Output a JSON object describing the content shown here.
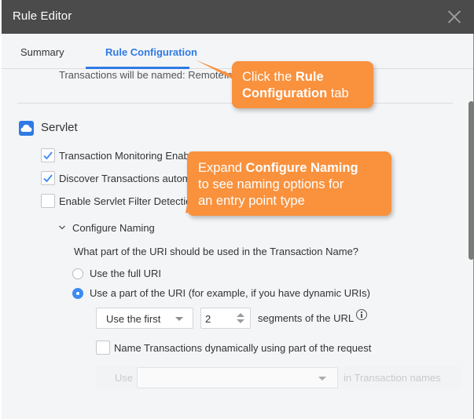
{
  "window": {
    "title": "Rule Editor",
    "close_icon": "close-icon"
  },
  "tabs": [
    {
      "label": "Summary",
      "active": false
    },
    {
      "label": "Rule Configuration",
      "active": true
    }
  ],
  "colors": {
    "accent": "#2f7ae5",
    "titlebar": "#4b4b4b",
    "callout": "#f9913d",
    "background": "#f4f5f7"
  },
  "content": {
    "named_text": "Transactions will be named: RemoteInt",
    "section": {
      "icon": "cloud-icon",
      "title": "Servlet"
    },
    "checkboxes": [
      {
        "label": "Transaction Monitoring Enabled",
        "checked": true
      },
      {
        "label": "Discover Transactions automatically",
        "checked": true
      },
      {
        "label": "Enable Servlet Filter Detection",
        "checked": false
      }
    ],
    "configure_naming": {
      "label": "Configure Naming",
      "expanded": true,
      "question": "What part of the URI should be used in the Transaction Name?",
      "radios": [
        {
          "label": "Use the full URI",
          "checked": false
        },
        {
          "label": "Use a part of the URI (for example, if you have dynamic URIs)",
          "checked": true
        }
      ],
      "segment_mode": {
        "selected": "Use the first"
      },
      "segment_count": "2",
      "segments_suffix": "segments of the URL",
      "info_icon": "info-icon",
      "dynamic_checkbox": {
        "label": "Name Transactions dynamically using part of the request",
        "checked": false
      },
      "dynamic_row": {
        "prefix": "Use",
        "selected": "",
        "suffix": "in Transaction names",
        "disabled": true
      }
    }
  },
  "callouts": [
    {
      "text_pre": "Click the ",
      "bold": "Rule Configuration",
      "text_post": " tab"
    },
    {
      "bold": "Configure Naming",
      "text_pre": "Expand ",
      "line2": "to see naming options for",
      "line3": "an entry point type"
    }
  ]
}
